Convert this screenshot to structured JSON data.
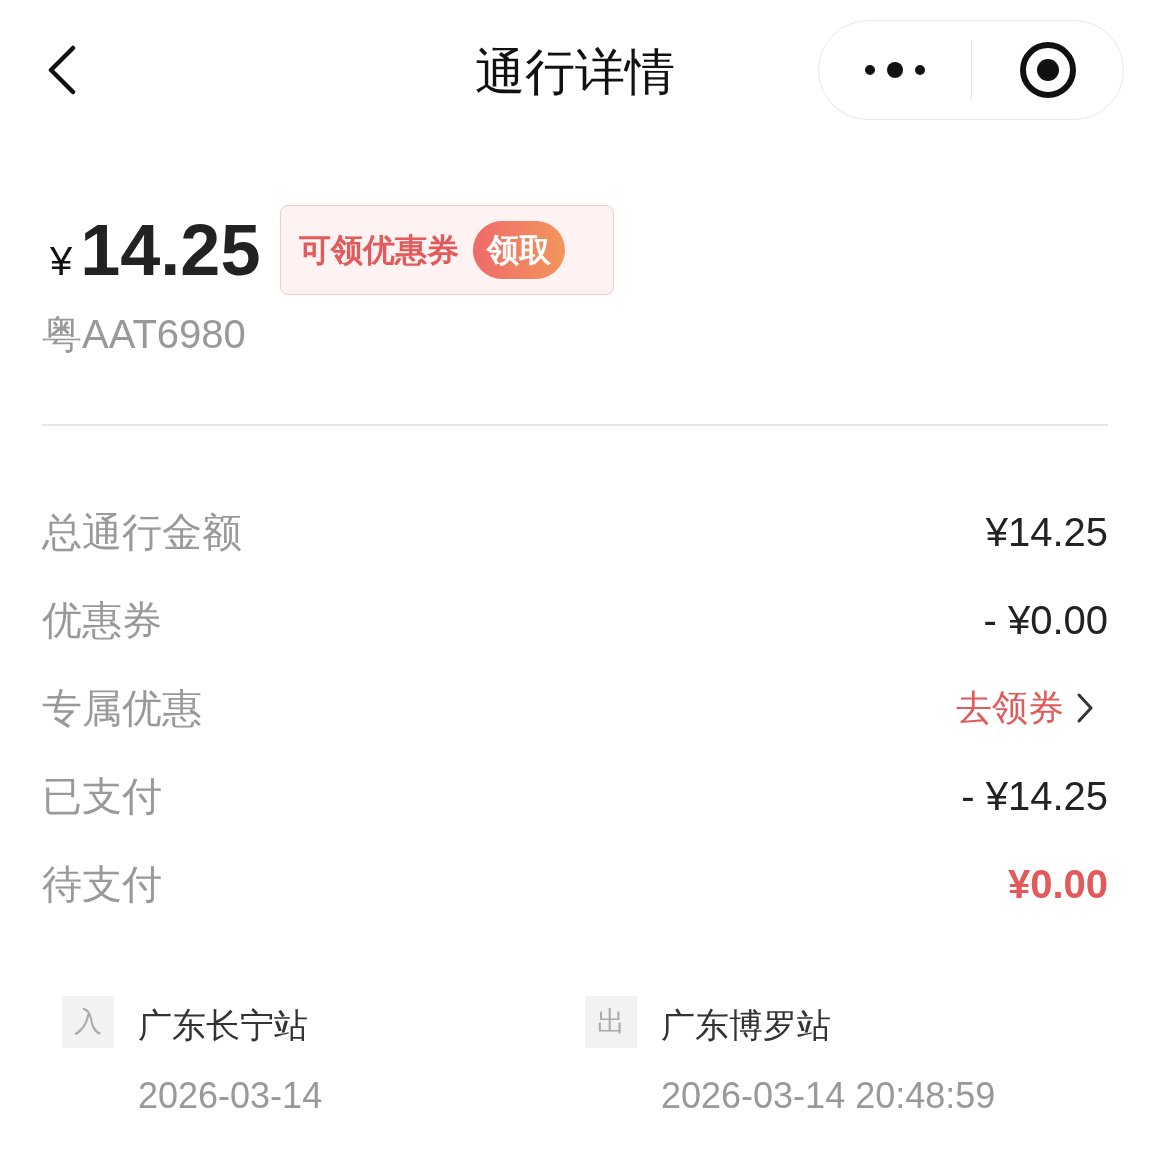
{
  "header": {
    "title": "通行详情"
  },
  "amount": {
    "currency": "¥",
    "value": "14.25"
  },
  "coupon_badge": {
    "label": "可领优惠券",
    "button": "领取"
  },
  "plate": "粤AAT6980",
  "rows": [
    {
      "label": "总通行金额",
      "value": "¥14.25",
      "kind": "amount"
    },
    {
      "label": "优惠券",
      "value": "- ¥0.00",
      "kind": "amount"
    },
    {
      "label": "专属优惠",
      "value": "去领券",
      "kind": "link"
    },
    {
      "label": "已支付",
      "value": "- ¥14.25",
      "kind": "amount"
    },
    {
      "label": "待支付",
      "value": "¥0.00",
      "kind": "due"
    }
  ],
  "stations": [
    {
      "tag": "入",
      "name": "广东长宁站",
      "time": "2026-03-14"
    },
    {
      "tag": "出",
      "name": "广东博罗站",
      "time": "2026-03-14 20:48:59"
    }
  ]
}
